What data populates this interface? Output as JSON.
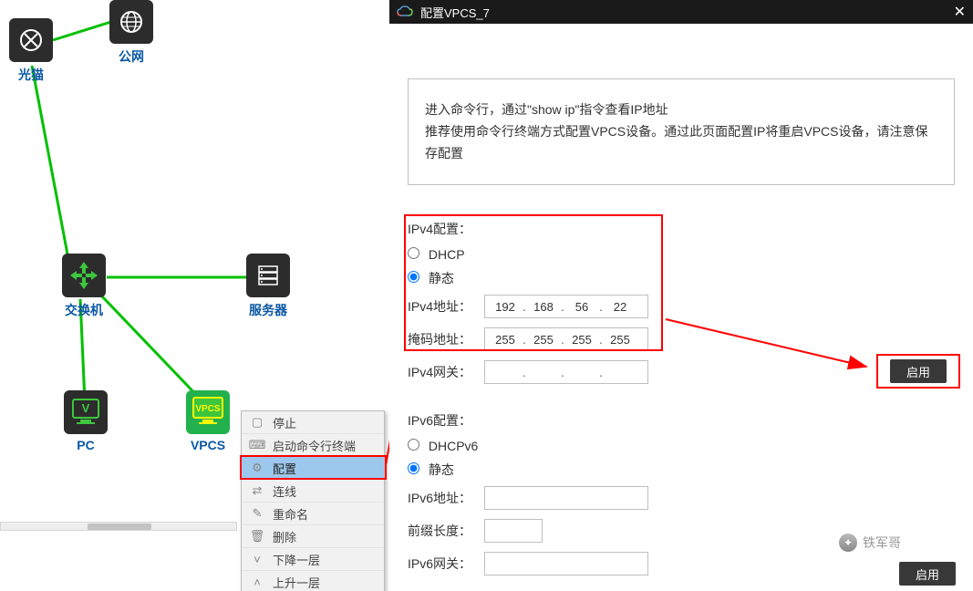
{
  "topology": {
    "optical_modem": "光猫",
    "public_net": "公网",
    "switch": "交换机",
    "server": "服务器",
    "pc": "PC",
    "vpcs": "VPCS"
  },
  "context_menu": {
    "stop": "停止",
    "open_terminal": "启动命令行终端",
    "configure": "配置",
    "link": "连线",
    "rename": "重命名",
    "delete": "删除",
    "lower": "下降一层",
    "raise": "上升一层"
  },
  "dialog": {
    "title": "配置VPCS_7",
    "notice_line1": "进入命令行，通过\"show ip\"指令查看IP地址",
    "notice_line2": "推荐使用命令行终端方式配置VPCS设备。通过此页面配置IP将重启VPCS设备，请注意保存配置",
    "ipv4": {
      "section": "IPv4配置：",
      "dhcp": "DHCP",
      "static": "静态",
      "addr_label": "IPv4地址：",
      "addr": {
        "o1": "192",
        "o2": "168",
        "o3": "56",
        "o4": "22"
      },
      "mask_label": "掩码地址：",
      "mask": {
        "o1": "255",
        "o2": "255",
        "o3": "255",
        "o4": "255"
      },
      "gw_label": "IPv4网关："
    },
    "ipv6": {
      "section": "IPv6配置：",
      "dhcp": "DHCPv6",
      "static": "静态",
      "addr_label": "IPv6地址：",
      "prefix_label": "前缀长度：",
      "gw_label": "IPv6网关："
    },
    "apply": "启用"
  },
  "watermark": "铁军哥"
}
